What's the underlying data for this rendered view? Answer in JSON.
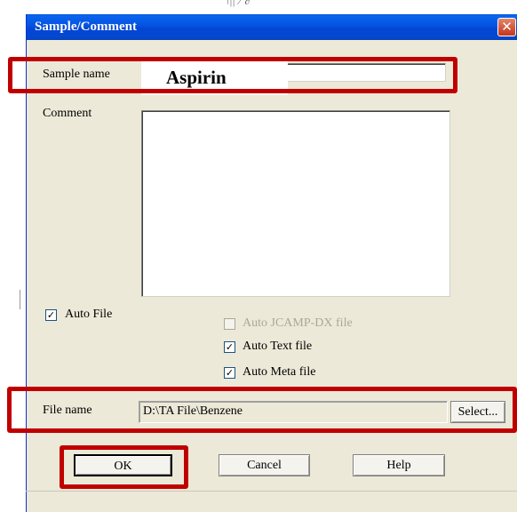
{
  "background": {
    "top_text": "ו|| ∕ ∂"
  },
  "dialog": {
    "title": "Sample/Comment",
    "close_glyph": "✕",
    "sample_name": {
      "label": "Sample name",
      "value": "Aspirin"
    },
    "comment": {
      "label": "Comment",
      "value": ""
    },
    "options": {
      "auto_file": {
        "label": "Auto File",
        "checked": true
      },
      "auto_jcamp": {
        "label": "Auto JCAMP-DX file",
        "checked": false,
        "enabled": false
      },
      "auto_text": {
        "label": "Auto Text file",
        "checked": true
      },
      "auto_meta": {
        "label": "Auto Meta file",
        "checked": true
      }
    },
    "file_name": {
      "label": "File name",
      "value": "D:\\TA File\\Benzene",
      "select_label": "Select..."
    },
    "buttons": {
      "ok": "OK",
      "cancel": "Cancel",
      "help": "Help"
    }
  },
  "colors": {
    "titlebar": "#0553e0",
    "dialog_bg": "#ece9d8",
    "highlight": "#c00000"
  }
}
